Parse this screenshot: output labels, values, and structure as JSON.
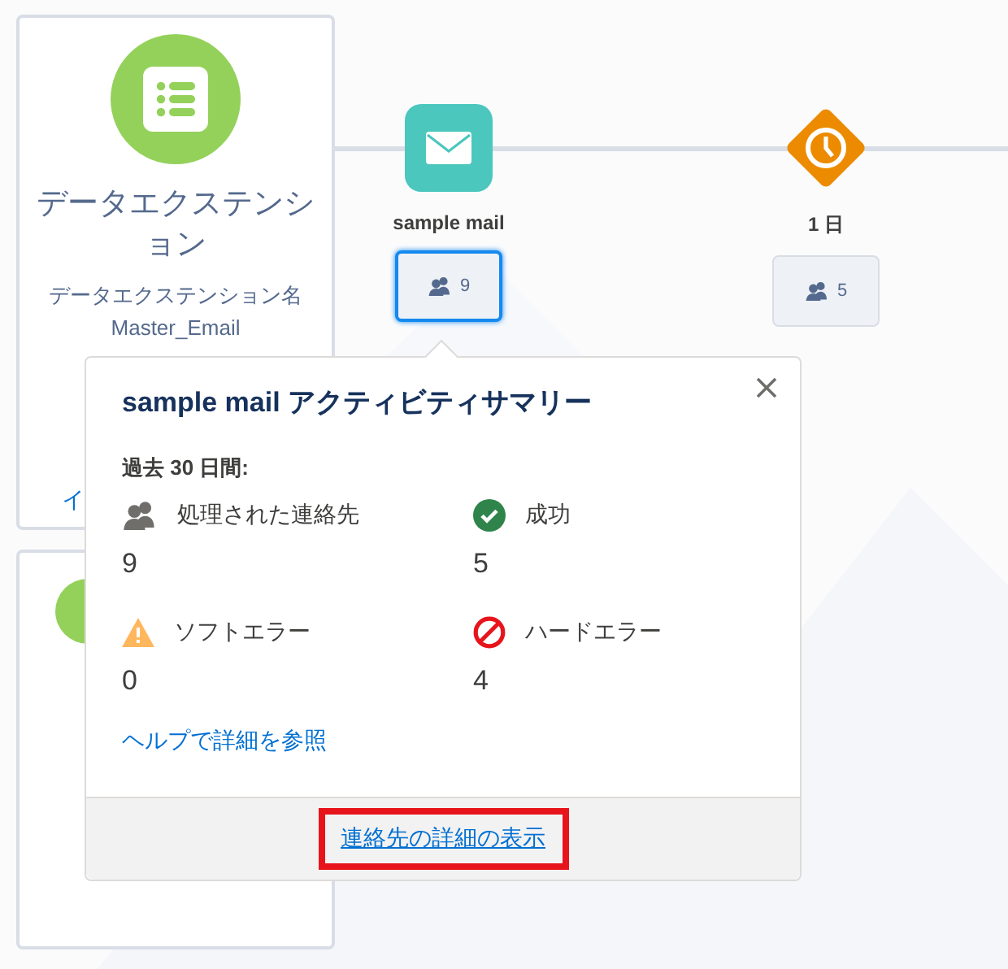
{
  "entry_card": {
    "title": "データエクステンション",
    "label": "データエクステンション名",
    "value": "Master_Email",
    "link": "イ"
  },
  "activities": [
    {
      "kind": "email",
      "label": "sample mail",
      "count": "9",
      "selected": true
    },
    {
      "kind": "wait",
      "label": "1 日",
      "count": "5",
      "selected": false
    }
  ],
  "popover": {
    "title": "sample mail アクティビティサマリー",
    "period": "過去 30 日間:",
    "stats": [
      {
        "kind": "contacts",
        "label": "処理された連絡先",
        "value": "9"
      },
      {
        "kind": "success",
        "label": "成功",
        "value": "5"
      },
      {
        "kind": "soft_error",
        "label": "ソフトエラー",
        "value": "0"
      },
      {
        "kind": "hard_error",
        "label": "ハードエラー",
        "value": "4"
      }
    ],
    "help_link": "ヘルプで詳細を参照",
    "footer_link": {
      "label": "連絡先の詳細の表示",
      "highlighted": true
    }
  }
}
